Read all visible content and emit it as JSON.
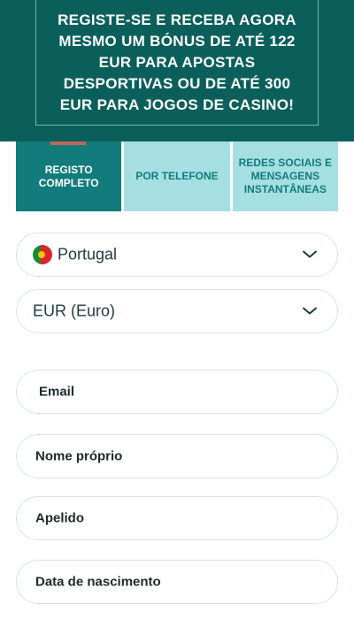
{
  "banner": {
    "text": "REGISTE-SE E RECEBA AGORA MESMO UM BÓNUS DE ATÉ 122 EUR PARA APOSTAS DESPORTIVAS OU DE ATÉ 300 EUR PARA JOGOS DE CASINO!"
  },
  "tabs": [
    {
      "label": "REGISTO COMPLETO",
      "active": true
    },
    {
      "label": "POR TELEFONE",
      "active": false
    },
    {
      "label": "REDES SOCIAIS E MENSAGENS INSTANTÂNEAS",
      "active": false
    }
  ],
  "country": {
    "value": "Portugal",
    "flag_icon": "portugal-flag-icon"
  },
  "currency": {
    "value": "EUR (Euro)"
  },
  "form": {
    "email": "Email",
    "first_name": "Nome próprio",
    "last_name": "Apelido",
    "birth_date": "Data de nascimento"
  },
  "colors": {
    "banner_bg": "#0b5f5b",
    "tab_active": "#127c7c",
    "tab_inactive": "#a5dfe2"
  }
}
